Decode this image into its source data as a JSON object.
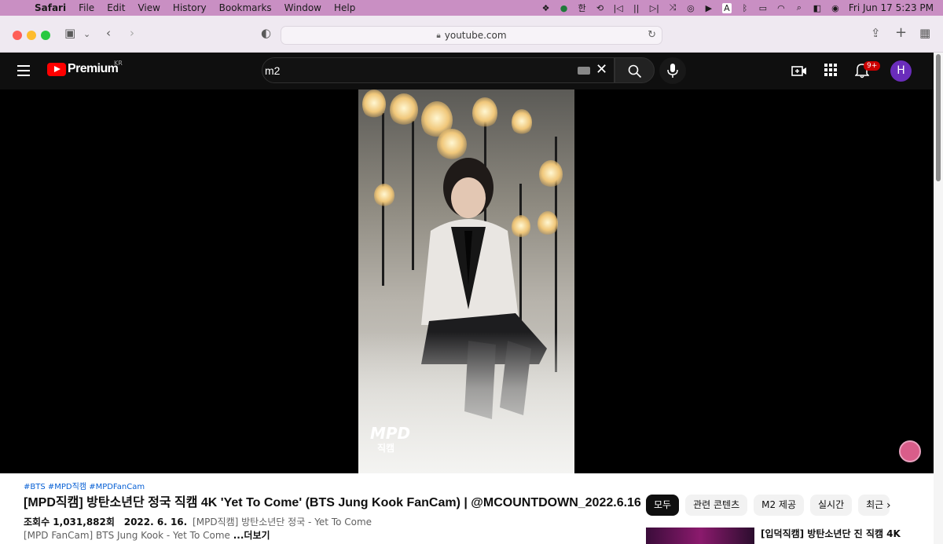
{
  "menubar": {
    "app": "Safari",
    "items": [
      "File",
      "Edit",
      "View",
      "History",
      "Bookmarks",
      "Window",
      "Help"
    ],
    "status_icons": [
      "dropbox-icon",
      "grammarly-icon",
      "korean-input-icon",
      "rewind-icon",
      "previous-icon",
      "pause-icon",
      "next-icon",
      "shuffle-icon",
      "sync-icon",
      "play-icon",
      "input-a-icon",
      "bluetooth-icon",
      "battery-icon",
      "wifi-icon",
      "spotlight-icon",
      "control-center-icon",
      "siri-icon"
    ],
    "input_label": "한",
    "input_letter": "A",
    "clock": "Fri Jun 17  5:23 PM"
  },
  "browser": {
    "url": "youtube.com"
  },
  "youtube": {
    "brand": "Premium",
    "region": "KR",
    "search_query": "m2",
    "notification_count": "9+",
    "avatar_letter": "H",
    "colors": {
      "logo": "#ff0000",
      "avatar": "#6a2dbb",
      "badge": "#cc0000",
      "link": "#065fd4"
    }
  },
  "video": {
    "overlay_logo": "MPD",
    "overlay_sub": "직캠",
    "hashtags": "#BTS #MPD직캠 #MPDFanCam",
    "title": "[MPD직캠] 방탄소년단 정국 직캠 4K 'Yet To Come' (BTS Jung Kook FanCam) | @MCOUNTDOWN_2022.6.16",
    "views": "조회수 1,031,882회",
    "date": "2022. 6. 16.",
    "desc_line1": "[MPD직캠] 방탄소년단 정국 - Yet To Come",
    "desc_line2": "[MPD FanCam] BTS Jung Kook - Yet To Come",
    "more": "...더보기"
  },
  "chips": [
    "모두",
    "관련 콘텐츠",
    "M2 제공",
    "실시간",
    "최근"
  ],
  "recommendation": {
    "title": "[입덕직캠] 방탄소년단 진 직캠 4K"
  }
}
